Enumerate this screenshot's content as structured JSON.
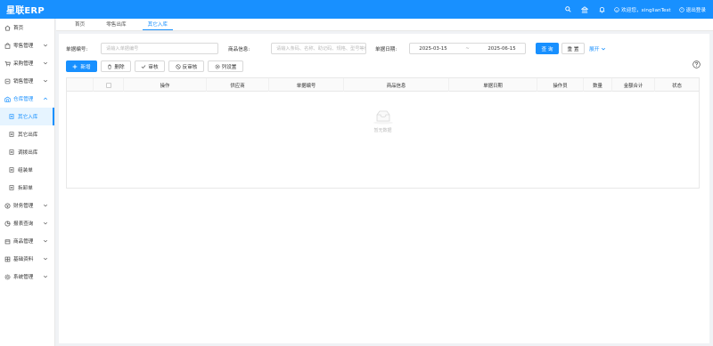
{
  "app": {
    "logo": "星联ERP"
  },
  "header": {
    "welcome": "欢迎您，xinglianTest",
    "logout": "退出登录"
  },
  "sidebar": {
    "items": [
      {
        "label": "首页",
        "icon": "home-icon"
      },
      {
        "label": "零售管理",
        "icon": "shop-icon"
      },
      {
        "label": "采购管理",
        "icon": "cart-icon"
      },
      {
        "label": "销售管理",
        "icon": "sales-icon"
      },
      {
        "label": "仓库管理",
        "icon": "warehouse-icon"
      },
      {
        "label": "财务管理",
        "icon": "finance-icon"
      },
      {
        "label": "报表查询",
        "icon": "report-icon"
      },
      {
        "label": "商品管理",
        "icon": "product-icon"
      },
      {
        "label": "基础资料",
        "icon": "basic-icon"
      },
      {
        "label": "系统管理",
        "icon": "system-icon"
      }
    ],
    "warehouse_sub": [
      {
        "label": "其它入库"
      },
      {
        "label": "其它出库"
      },
      {
        "label": "调拨出库"
      },
      {
        "label": "组装单"
      },
      {
        "label": "拆卸单"
      }
    ]
  },
  "tabs": [
    {
      "label": "首页"
    },
    {
      "label": "零售出库"
    },
    {
      "label": "其它入库"
    }
  ],
  "search": {
    "bill_no_label": "单据编号:",
    "bill_no_placeholder": "请输入单据编号",
    "goods_label": "商品信息:",
    "goods_placeholder": "请输入条码、名称、助记码、规格、型号等信...",
    "date_label": "单据日期:",
    "date_start": "2025-03-15",
    "date_sep": "~",
    "date_end": "2025-06-15",
    "query": "查 询",
    "reset": "重 置",
    "expand": "展开"
  },
  "toolbar": {
    "add": "新增",
    "delete": "删除",
    "audit": "审核",
    "unaudit": "反审核",
    "columns": "列设置"
  },
  "table": {
    "columns": [
      "操作",
      "供应商",
      "单据编号",
      "商品信息",
      "单据日期",
      "操作员",
      "数量",
      "金额合计",
      "状态"
    ],
    "empty_text": "暂无数据"
  },
  "colors": {
    "primary": "#1890ff",
    "active_bg": "#e6f4ff"
  }
}
